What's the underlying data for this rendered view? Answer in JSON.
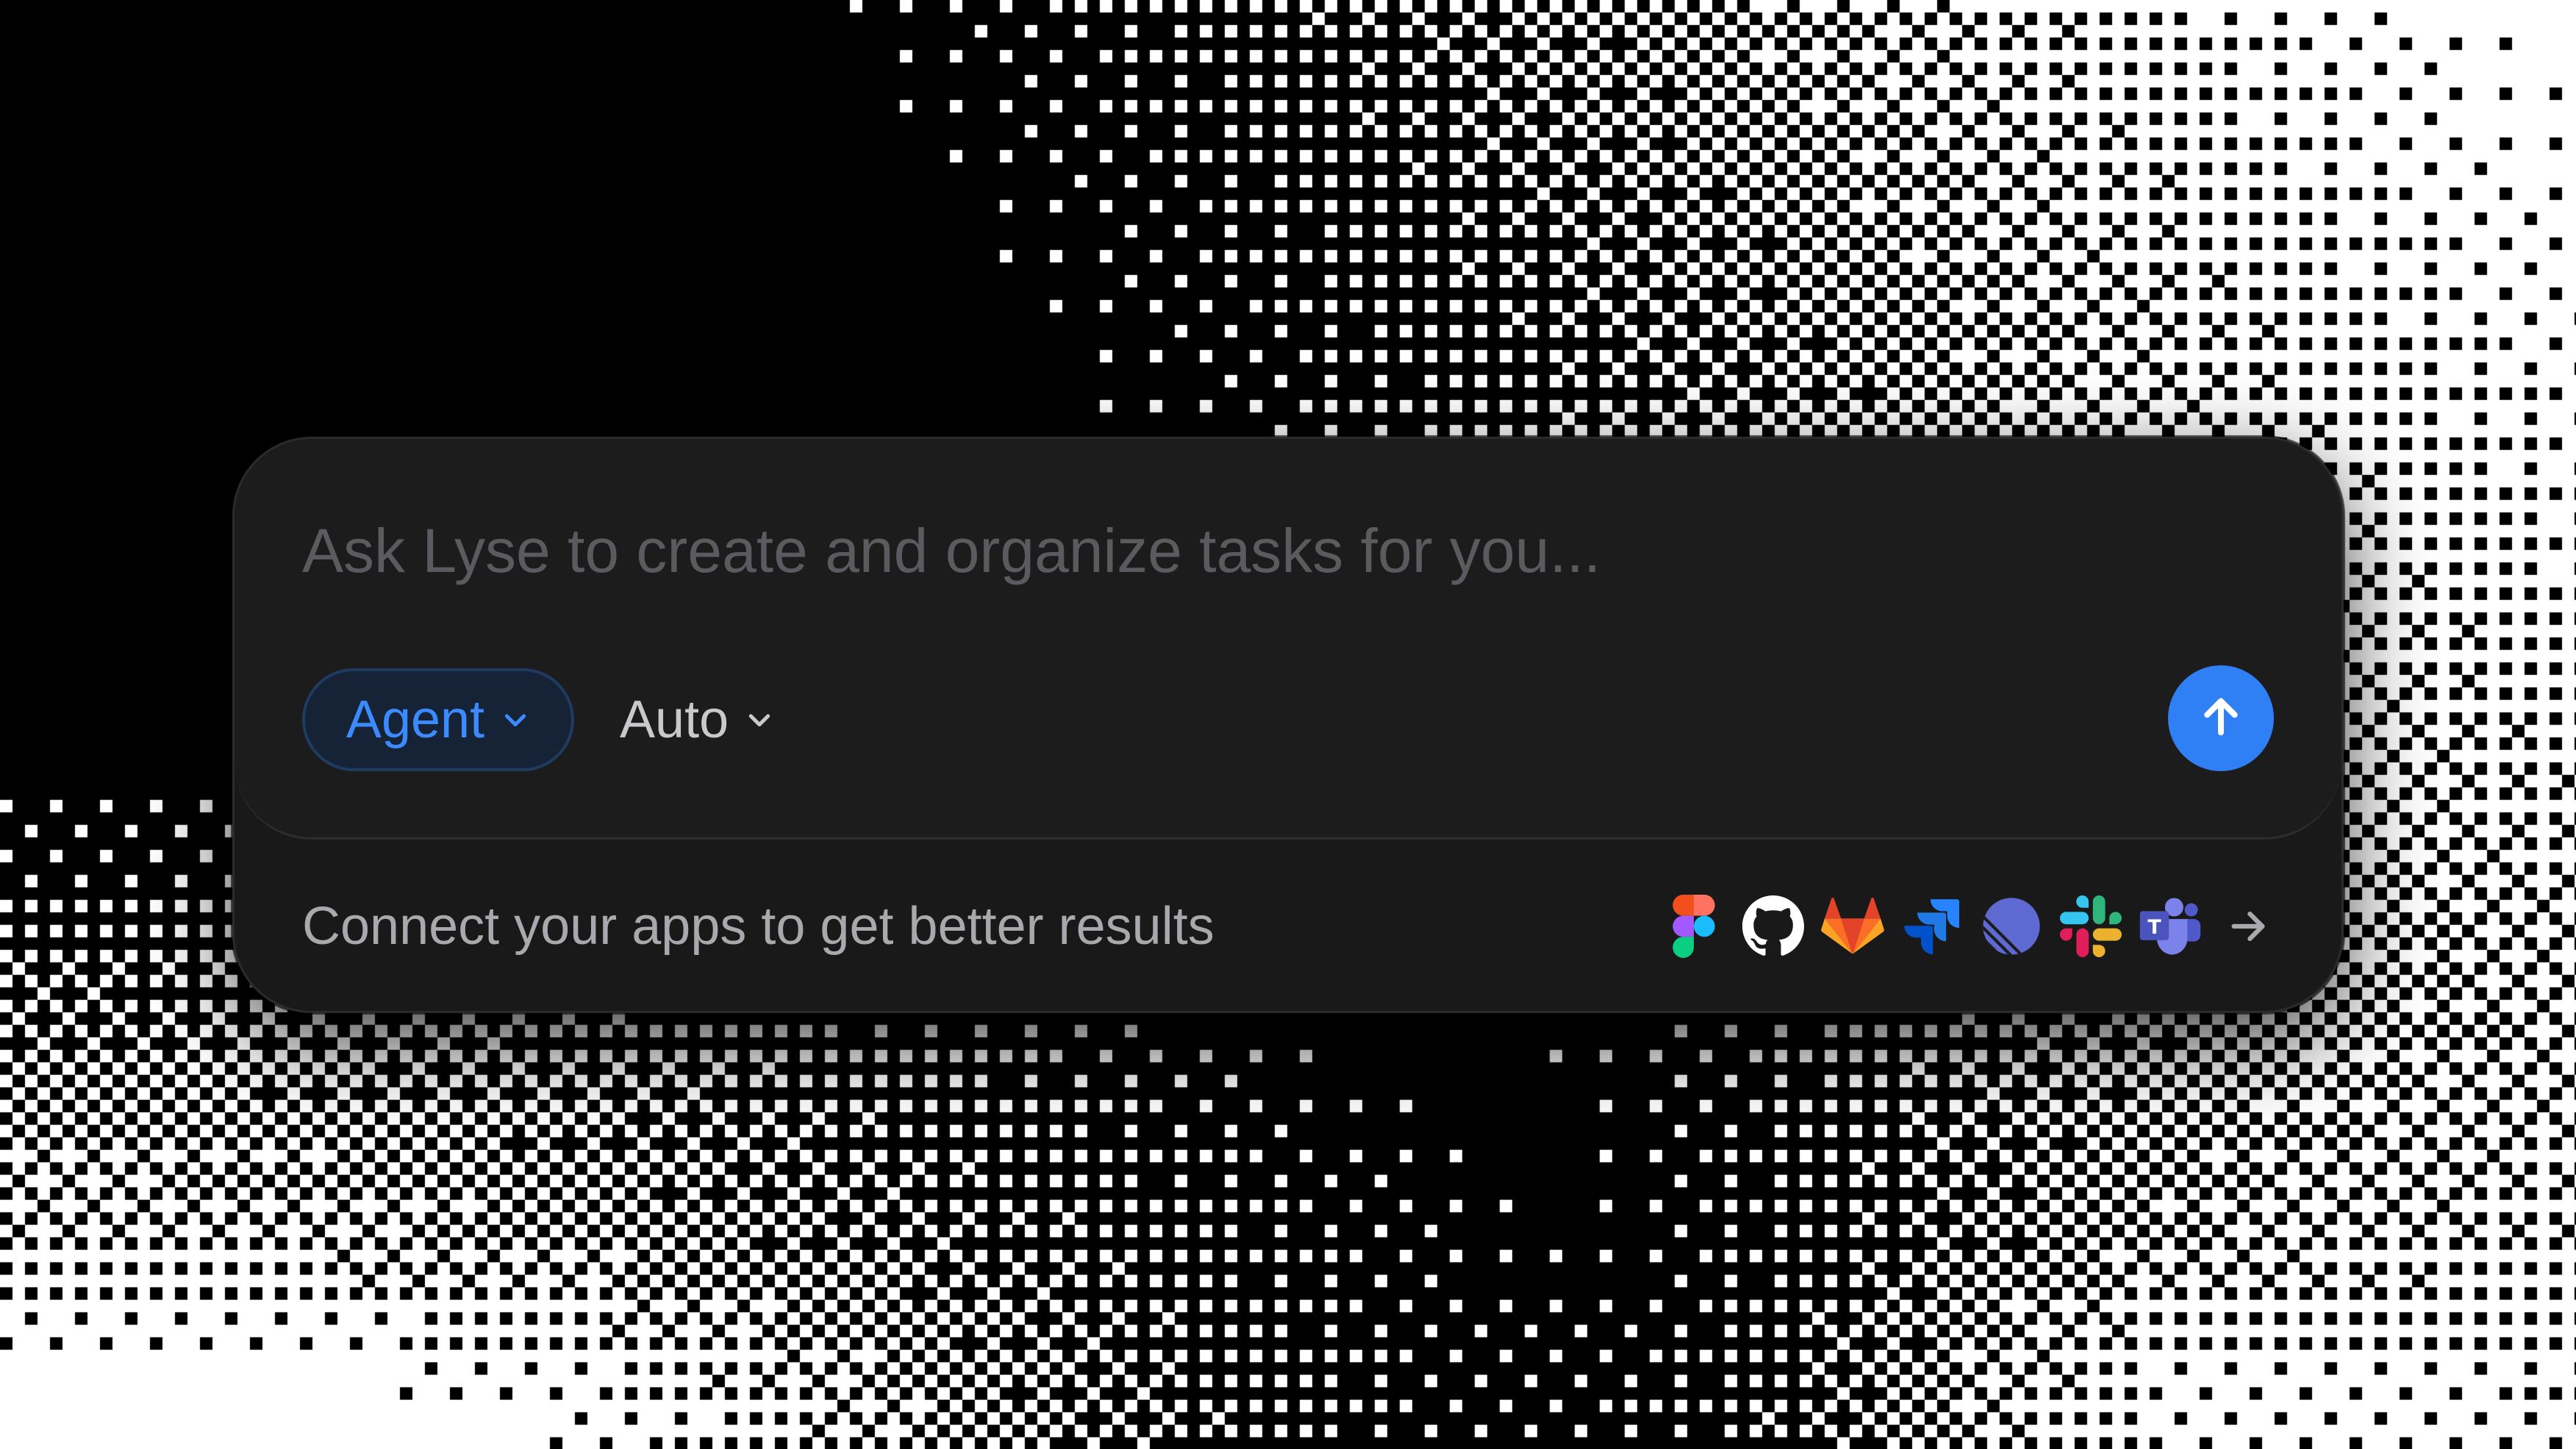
{
  "composer": {
    "placeholder": "Ask Lyse to create and organize tasks for you...",
    "mode": {
      "label": "Agent"
    },
    "model": {
      "label": "Auto"
    },
    "send_icon": "arrow-up-icon"
  },
  "connect": {
    "text": "Connect your apps to get better results",
    "apps": [
      {
        "name": "figma",
        "icon": "figma-icon"
      },
      {
        "name": "github",
        "icon": "github-icon"
      },
      {
        "name": "gitlab",
        "icon": "gitlab-icon"
      },
      {
        "name": "jira",
        "icon": "jira-icon"
      },
      {
        "name": "linear",
        "icon": "linear-icon"
      },
      {
        "name": "slack",
        "icon": "slack-icon"
      },
      {
        "name": "teams",
        "icon": "teams-icon"
      }
    ],
    "more_icon": "arrow-right-icon"
  },
  "colors": {
    "background": "#000000",
    "surface": "#191919",
    "accent": "#2f80f5",
    "agent_text": "#3b8bff"
  }
}
